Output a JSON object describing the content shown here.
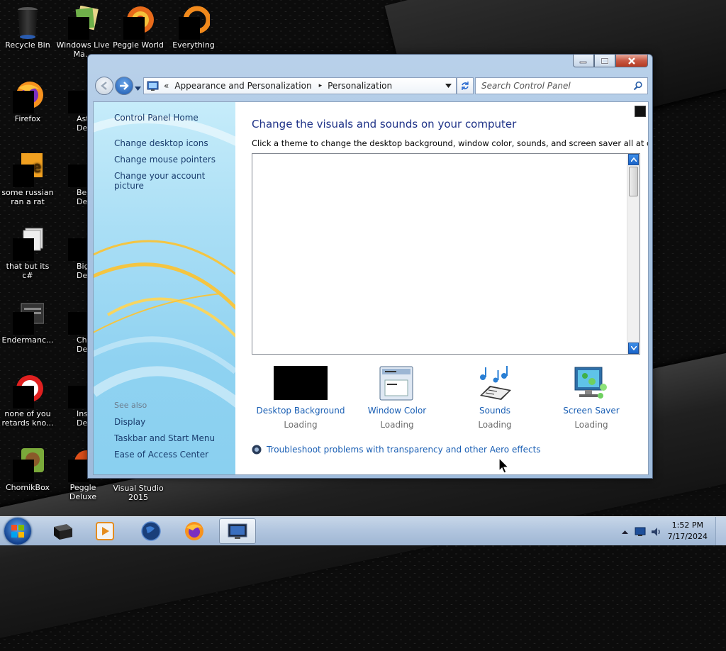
{
  "desktop": {
    "icons": [
      {
        "label": "Recycle Bin"
      },
      {
        "label": "Windows Live Ma..."
      },
      {
        "label": "Peggle World"
      },
      {
        "label": "Everything"
      },
      {
        "label": "Firefox"
      },
      {
        "label": "Astrol... Delu"
      },
      {
        "label": "some russian ran a rat"
      },
      {
        "label": "Bejew... Delu"
      },
      {
        "label": "that but its c#"
      },
      {
        "label": "Big M... Delu"
      },
      {
        "label": "Endermanc..."
      },
      {
        "label": "Chuz... Delu"
      },
      {
        "label": "none of you retards kno..."
      },
      {
        "label": "Insaniq... Delu"
      },
      {
        "label": "ChomikBox"
      },
      {
        "label": "Peggle Deluxe"
      },
      {
        "label": "Visual Studio 2015"
      }
    ]
  },
  "window": {
    "breadcrumb": {
      "prefix": "«",
      "parent": "Appearance and Personalization",
      "separator": "▸",
      "current": "Personalization"
    },
    "search_placeholder": "Search Control Panel",
    "sidebar": {
      "home": "Control Panel Home",
      "links": [
        "Change desktop icons",
        "Change mouse pointers",
        "Change your account picture"
      ],
      "see_also_heading": "See also",
      "see_also": [
        "Display",
        "Taskbar and Start Menu",
        "Ease of Access Center"
      ]
    },
    "main": {
      "title": "Change the visuals and sounds on your computer",
      "description": "Click a theme to change the desktop background, window color, sounds, and screen saver all at once.",
      "options": [
        {
          "label": "Desktop Background",
          "status": "Loading",
          "icon": "desktop-background-icon"
        },
        {
          "label": "Window Color",
          "status": "Loading",
          "icon": "window-color-icon"
        },
        {
          "label": "Sounds",
          "status": "Loading",
          "icon": "sounds-icon"
        },
        {
          "label": "Screen Saver",
          "status": "Loading",
          "icon": "screen-saver-icon"
        }
      ],
      "troubleshoot_link": "Troubleshoot problems with transparency and other Aero effects"
    }
  },
  "taskbar": {
    "clock_time": "1:52 PM",
    "clock_date": "7/17/2024"
  }
}
